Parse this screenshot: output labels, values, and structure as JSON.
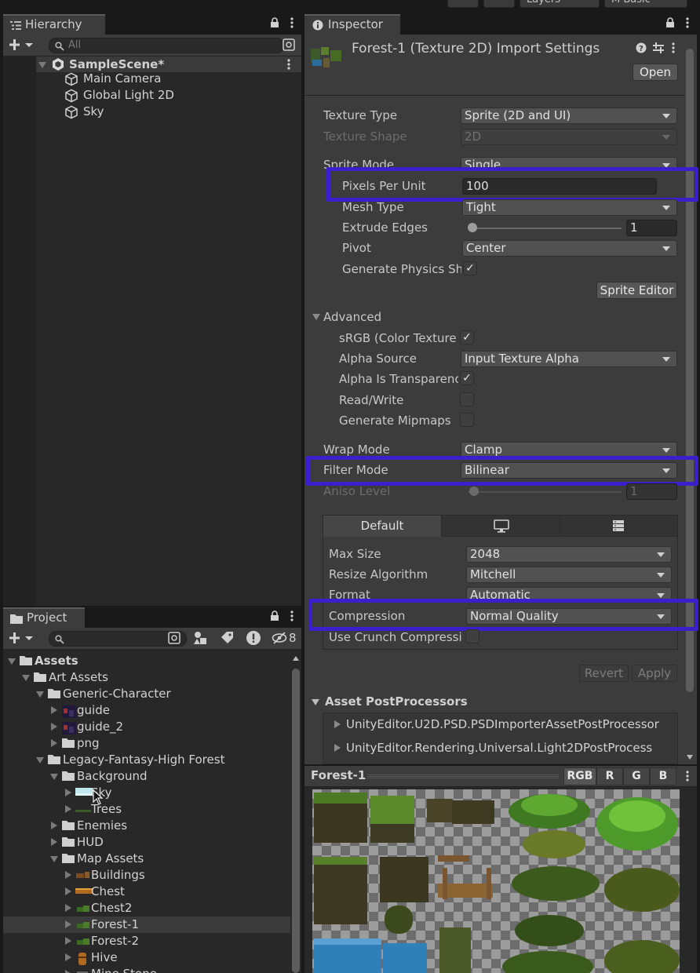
{
  "topbar": {
    "layers_label": "Layers",
    "layout_label": "M Basic"
  },
  "hierarchy": {
    "tab_label": "Hierarchy",
    "search_placeholder": "All",
    "scene_name": "SampleScene*",
    "objects": [
      "Main Camera",
      "Global Light 2D",
      "Sky"
    ]
  },
  "project": {
    "tab_label": "Project",
    "hidden_count": "8",
    "tree": [
      "Assets",
      "Art Assets",
      "Generic-Character",
      "guide",
      "guide_2",
      "png",
      "Legacy-Fantasy-High Forest",
      "Background",
      "Sky",
      "Trees",
      "Enemies",
      "HUD",
      "Map Assets",
      "Buildings",
      "Chest",
      "Chest2",
      "Forest-1",
      "Forest-2",
      "Hive",
      "Mine Stone"
    ]
  },
  "inspector": {
    "tab_label": "Inspector",
    "title": "Forest-1 (Texture 2D) Import Settings",
    "open_button": "Open",
    "fields": {
      "texture_type": {
        "label": "Texture Type",
        "value": "Sprite (2D and UI)"
      },
      "texture_shape": {
        "label": "Texture Shape",
        "value": "2D"
      },
      "sprite_mode": {
        "label": "Sprite Mode",
        "value": "Single"
      },
      "pixels_per_unit": {
        "label": "Pixels Per Unit",
        "value": "100"
      },
      "mesh_type": {
        "label": "Mesh Type",
        "value": "Tight"
      },
      "extrude_edges": {
        "label": "Extrude Edges",
        "value": "1"
      },
      "pivot": {
        "label": "Pivot",
        "value": "Center"
      },
      "generate_physics": {
        "label": "Generate Physics Sh"
      },
      "sprite_editor_button": "Sprite Editor",
      "advanced": "Advanced",
      "srgb": {
        "label": "sRGB (Color Texture"
      },
      "alpha_source": {
        "label": "Alpha Source",
        "value": "Input Texture Alpha"
      },
      "alpha_transparency": {
        "label": "Alpha Is Transparenc"
      },
      "read_write": {
        "label": "Read/Write"
      },
      "mipmaps": {
        "label": "Generate Mipmaps"
      },
      "wrap_mode": {
        "label": "Wrap Mode",
        "value": "Clamp"
      },
      "filter_mode": {
        "label": "Filter Mode",
        "value": "Bilinear"
      },
      "aniso_level": {
        "label": "Aniso Level",
        "value": "1"
      }
    },
    "platform": {
      "tab_default": "Default",
      "max_size": {
        "label": "Max Size",
        "value": "2048"
      },
      "resize": {
        "label": "Resize Algorithm",
        "value": "Mitchell"
      },
      "format": {
        "label": "Format",
        "value": "Automatic"
      },
      "compression": {
        "label": "Compression",
        "value": "Normal Quality"
      },
      "crunch": {
        "label": "Use Crunch Compressi"
      }
    },
    "revert_button": "Revert",
    "apply_button": "Apply",
    "postprocessors": {
      "title": "Asset PostProcessors",
      "items": [
        "UnityEditor.U2D.PSD.PSDImporterAssetPostProcessor",
        "UnityEditor.Rendering.Universal.Light2DPostProcess"
      ]
    }
  },
  "preview": {
    "title": "Forest-1",
    "channels": [
      "RGB",
      "R",
      "G",
      "B"
    ]
  },
  "colors": {
    "highlight": "#3b1fcc",
    "panel_bg": "#282828",
    "tab_bg": "#3c3c3c"
  }
}
